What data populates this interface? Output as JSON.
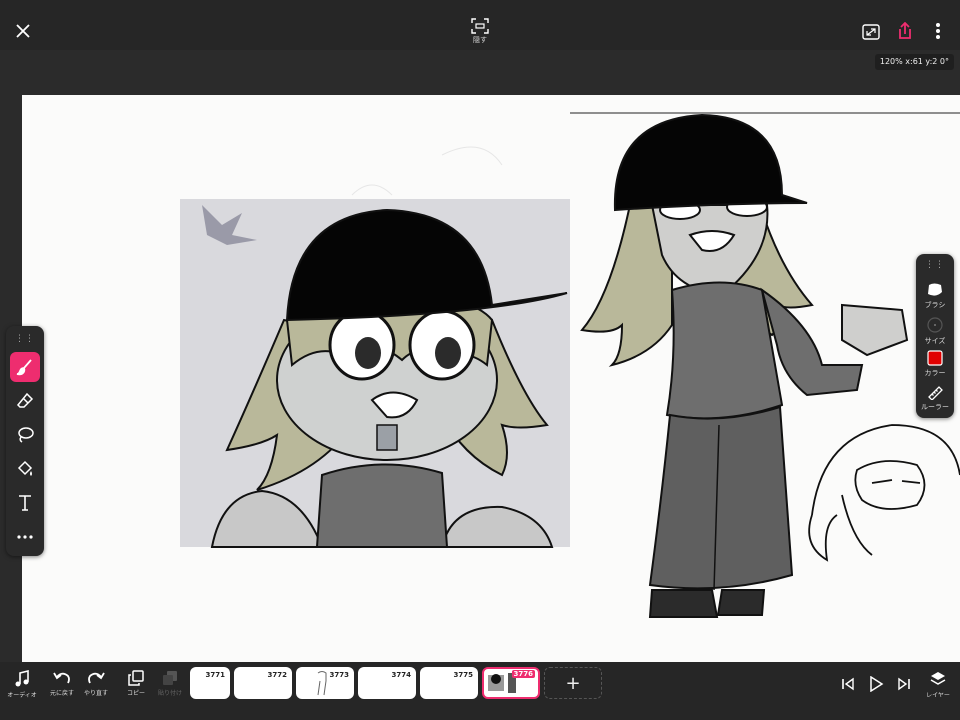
{
  "topbar": {
    "hide_label": "隠す",
    "zoom_readout": "120% x:61 y:2 0°"
  },
  "right_palette": {
    "brush_label": "ブラシ",
    "size_label": "サイズ",
    "color_label": "カラー",
    "ruler_label": "ルーラー",
    "current_color": "#e00000"
  },
  "bottombar": {
    "audio_label": "オーディオ",
    "undo_label": "元に戻す",
    "redo_label": "やり直す",
    "copy_label": "コピー",
    "paste_label": "貼り付け",
    "layer_label": "レイヤー"
  },
  "frames": [
    {
      "number": "3771"
    },
    {
      "number": "3772"
    },
    {
      "number": "3773"
    },
    {
      "number": "3774"
    },
    {
      "number": "3775"
    },
    {
      "number": "3776"
    }
  ],
  "add_frame_label": "+",
  "colors": {
    "accent": "#ee2d6f",
    "toolbar_bg": "#262626",
    "canvas_bg": "#fbfbfa"
  }
}
